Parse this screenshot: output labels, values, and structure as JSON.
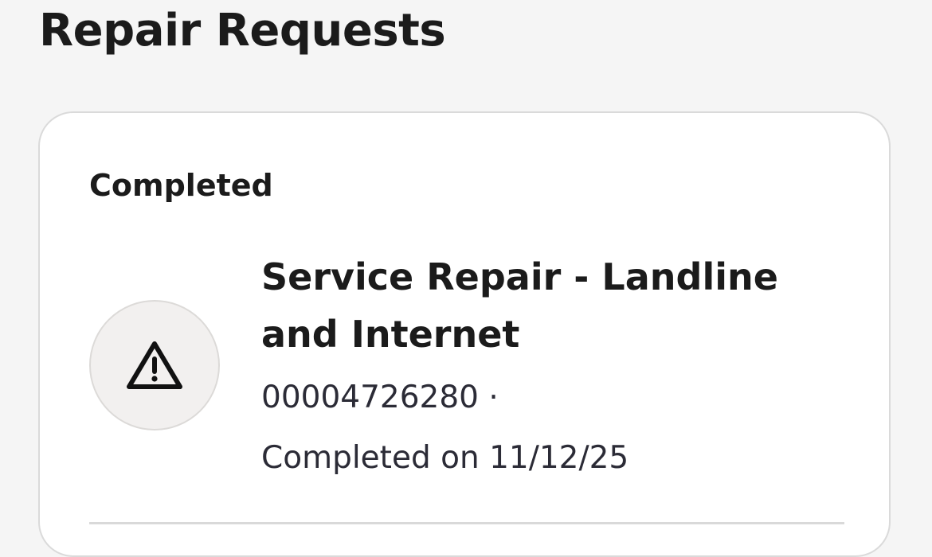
{
  "page": {
    "title": "Repair Requests"
  },
  "section": {
    "heading": "Completed"
  },
  "request": {
    "title": "Service Repair - Landline and Internet",
    "id_text": "00004726280 ·",
    "status_text": "Completed on 11/12/25",
    "icon": "warning-icon"
  },
  "colors": {
    "background": "#f5f5f5",
    "card": "#ffffff",
    "icon_circle": "#f2f0ef",
    "text_primary": "#1b1b1b",
    "text_secondary": "#2b2b36"
  }
}
